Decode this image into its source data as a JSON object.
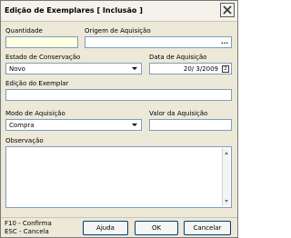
{
  "window": {
    "title": "Edição de Exemplares [ Inclusão ]",
    "close_icon": "close-icon"
  },
  "form": {
    "quantidade": {
      "label": "Quantidade",
      "value": ""
    },
    "origem": {
      "label": "Origem de Aquisição",
      "value": "",
      "button": "..."
    },
    "estado": {
      "label": "Estado de Conservação",
      "value": "Novo"
    },
    "data_aquisicao": {
      "label": "Data de Aquisição",
      "value": "20/ 3/2009",
      "calendar_icon": "calendar-icon"
    },
    "edicao": {
      "label": "Edição do Exemplar",
      "value": ""
    },
    "modo": {
      "label": "Modo de Aquisição",
      "value": "Compra"
    },
    "valor": {
      "label": "Valor da Aquisição",
      "value": ""
    },
    "observacao": {
      "label": "Observação",
      "value": ""
    }
  },
  "footer": {
    "hint1": "F10 - Confirma",
    "hint2": "ESC - Cancela",
    "help_label": "Ajuda",
    "ok_label": "OK",
    "cancel_label": "Cancelar"
  }
}
